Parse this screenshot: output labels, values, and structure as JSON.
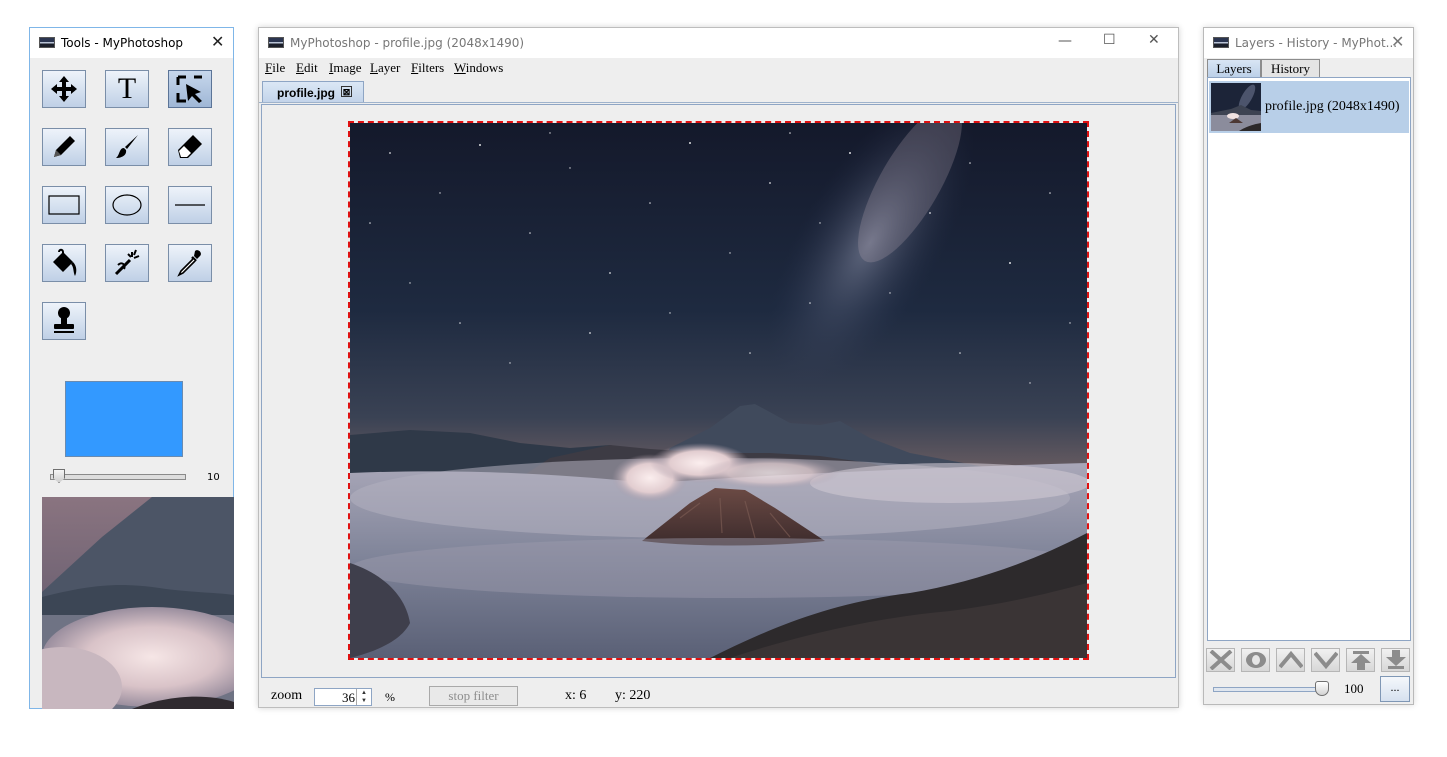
{
  "tools_window": {
    "title": "Tools - MyPhotoshop",
    "tools": [
      {
        "name": "move-tool",
        "icon": "move-arrows-icon"
      },
      {
        "name": "text-tool",
        "icon": "text-t-icon",
        "glyph": "T"
      },
      {
        "name": "selection-tool",
        "icon": "select-arrow-icon"
      },
      {
        "name": "pencil-tool",
        "icon": "pencil-icon"
      },
      {
        "name": "brush-tool",
        "icon": "brush-icon"
      },
      {
        "name": "eraser-tool",
        "icon": "eraser-icon"
      },
      {
        "name": "rectangle-tool",
        "icon": "rectangle-icon"
      },
      {
        "name": "ellipse-tool",
        "icon": "ellipse-icon"
      },
      {
        "name": "line-tool",
        "icon": "line-icon"
      },
      {
        "name": "paint-bucket-tool",
        "icon": "paint-bucket-icon"
      },
      {
        "name": "magic-wand-tool",
        "icon": "magic-wand-icon"
      },
      {
        "name": "eyedropper-tool",
        "icon": "eyedropper-icon"
      },
      {
        "name": "stamp-tool",
        "icon": "stamp-icon"
      }
    ],
    "active_tool": "selection-tool",
    "color": "#3399ff",
    "brush_size": "10"
  },
  "main_window": {
    "title": "MyPhotoshop - profile.jpg (2048x1490)",
    "menu": [
      "File",
      "Edit",
      "Image",
      "Layer",
      "Filters",
      "Windows"
    ],
    "doc_tab": "profile.jpg",
    "doc_tab_close": "⊠",
    "status": {
      "zoom_label": "zoom",
      "zoom_value": "36",
      "percent": "%",
      "stop_filter": "stop filter",
      "x": "x: 6",
      "y": "y: 220"
    },
    "window_controls": {
      "minimize": "—",
      "maximize": "☐",
      "close": "✕"
    }
  },
  "layers_window": {
    "title": "Layers - History - MyPhot...",
    "tabs": [
      "Layers",
      "History"
    ],
    "active_tab": "Layers",
    "layers": [
      {
        "name": "profile.jpg (2048x1490)"
      }
    ],
    "opacity": "100",
    "more_button": "...",
    "buttons": [
      "delete-layer",
      "toggle-visibility",
      "move-up",
      "move-down",
      "move-top",
      "move-bottom"
    ]
  },
  "colors": {
    "selection_border": "#e01010",
    "accent": "#3399ff",
    "selection_highlight": "#b8cfe8"
  }
}
